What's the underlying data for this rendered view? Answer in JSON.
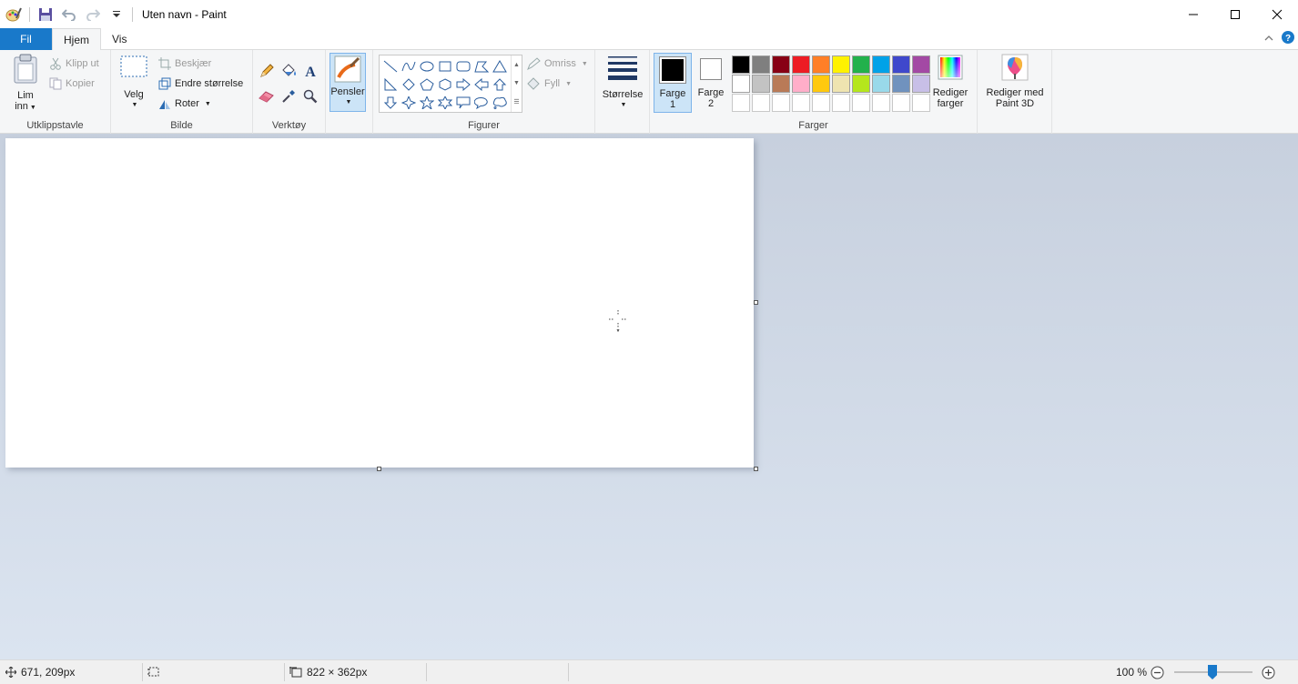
{
  "window": {
    "title": "Uten navn - Paint"
  },
  "tabs": [
    {
      "label": "Fil"
    },
    {
      "label": "Hjem"
    },
    {
      "label": "Vis"
    }
  ],
  "clipboard": {
    "paste_line1": "Lim",
    "paste_line2": "inn",
    "cut": "Klipp ut",
    "copy": "Kopier",
    "group": "Utklippstavle"
  },
  "image": {
    "select": "Velg",
    "crop": "Beskjær",
    "resize": "Endre størrelse",
    "rotate": "Roter",
    "group": "Bilde"
  },
  "tools": {
    "group": "Verktøy"
  },
  "brushes": {
    "label": "Pensler"
  },
  "shapes": {
    "outline": "Omriss",
    "fill": "Fyll",
    "group": "Figurer"
  },
  "size": {
    "label": "Størrelse"
  },
  "colors": {
    "color1_line1": "Farge",
    "color1_line2": "1",
    "color2_line1": "Farge",
    "color2_line2": "2",
    "edit_line1": "Rediger",
    "edit_line2": "farger",
    "paint3d_line1": "Rediger med",
    "paint3d_line2": "Paint 3D",
    "group": "Farger",
    "color1_value": "#000000",
    "color2_value": "#ffffff",
    "palette_row1": [
      "#000000",
      "#7f7f7f",
      "#880015",
      "#ed1c24",
      "#ff7f27",
      "#fff200",
      "#22b14c",
      "#00a2e8",
      "#3f48cc",
      "#a349a4"
    ],
    "palette_row2": [
      "#ffffff",
      "#c3c3c3",
      "#b97a57",
      "#ffaec9",
      "#ffc90e",
      "#efe4b0",
      "#b5e61d",
      "#99d9ea",
      "#7092be",
      "#c8bfe7"
    ]
  },
  "status": {
    "cursor_pos": "671, 209px",
    "canvas_size": "822 × 362px",
    "zoom": "100 %"
  }
}
